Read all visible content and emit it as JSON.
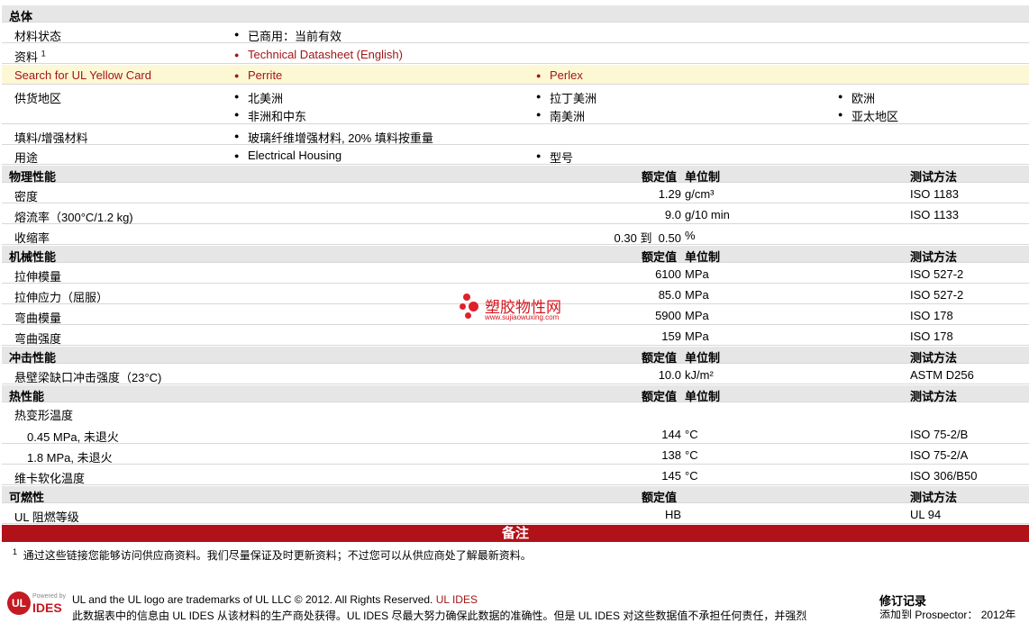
{
  "general": {
    "title": "总体",
    "status_label": "材料状态",
    "status_value": "已商用：当前有效",
    "docs_label": "资料",
    "docs_sup": "1",
    "docs_value": "Technical Datasheet (English)",
    "yellow_label": "Search for UL Yellow Card",
    "yellow_1": "Perrite",
    "yellow_2": "Perlex",
    "region_label": "供货地区",
    "regions": [
      "北美洲",
      "拉丁美洲",
      "欧洲",
      "非洲和中东",
      "南美洲",
      "亚太地区"
    ],
    "filler_label": "填料/增强材料",
    "filler_value": "玻璃纤维增强材料, 20% 填料按重量",
    "use_label": "用途",
    "use_1": "Electrical Housing",
    "use_2": "型号"
  },
  "headers": {
    "nominal": "额定值",
    "unit": "单位制",
    "method": "测试方法"
  },
  "physical": {
    "title": "物理性能",
    "rows": [
      {
        "label": "密度",
        "value": "1.29",
        "unit": "g/cm³",
        "method": "ISO 1183"
      },
      {
        "label": "熔流率（300°C/1.2 kg)",
        "value": "9.0",
        "unit": "g/10 min",
        "method": "ISO 1133"
      },
      {
        "label": "收缩率",
        "value": "0.30 到  0.50",
        "unit": "%",
        "method": ""
      }
    ]
  },
  "mechanical": {
    "title": "机械性能",
    "rows": [
      {
        "label": "拉伸模量",
        "value": "6100",
        "unit": "MPa",
        "method": "ISO 527-2"
      },
      {
        "label": "拉伸应力（屈服）",
        "value": "85.0",
        "unit": "MPa",
        "method": "ISO 527-2"
      },
      {
        "label": "弯曲模量",
        "value": "5900",
        "unit": "MPa",
        "method": "ISO 178"
      },
      {
        "label": "弯曲强度",
        "value": "159",
        "unit": "MPa",
        "method": "ISO 178"
      }
    ]
  },
  "impact": {
    "title": "冲击性能",
    "rows": [
      {
        "label": "悬壁梁缺口冲击强度（23°C)",
        "value": "10.0",
        "unit": "kJ/m²",
        "method": "ASTM D256"
      }
    ]
  },
  "thermal": {
    "title": "热性能",
    "group_label": "热变形温度",
    "rows": [
      {
        "label": "0.45 MPa, 未退火",
        "value": "144",
        "unit": "°C",
        "method": "ISO 75-2/B"
      },
      {
        "label": "1.8 MPa, 未退火",
        "value": "138",
        "unit": "°C",
        "method": "ISO 75-2/A"
      },
      {
        "label": "维卡软化温度",
        "value": "145",
        "unit": "°C",
        "method": "ISO 306/B50"
      }
    ]
  },
  "flammability": {
    "title": "可燃性",
    "rows": [
      {
        "label": "UL 阻燃等级",
        "value": "HB",
        "unit": "",
        "method": "UL 94"
      }
    ]
  },
  "notes": {
    "title": "备注",
    "sup": "1",
    "text": "通过这些链接您能够访问供应商资料。我们尽量保证及时更新资料；不过您可以从供应商处了解最新资料。"
  },
  "footer": {
    "logo_text": "UL",
    "logo_small": "Powered by",
    "logo_ides": "IDES",
    "trademark": "UL and the UL logo are trademarks of UL LLC © 2012. All Rights Reserved. ",
    "trademark_link": "UL IDES",
    "disclaimer": "此数据表中的信息由  UL IDES 从该材料的生产商处获得。UL IDES 尽最大努力确保此数据的准确性。但是  UL IDES 对这些数据值不承担任何责任，并强烈",
    "revision_title": "修订记录",
    "revision_text": "添加到  Prospector：  2012年"
  },
  "watermark": {
    "name": "塑胶物性网",
    "url": "www.sujiaowuxing.com"
  },
  "colors": {
    "accent_red": "#b1121a",
    "link": "#a01618",
    "section_bg": "#e6e6e6",
    "highlight_bg": "#fdf8d4"
  }
}
